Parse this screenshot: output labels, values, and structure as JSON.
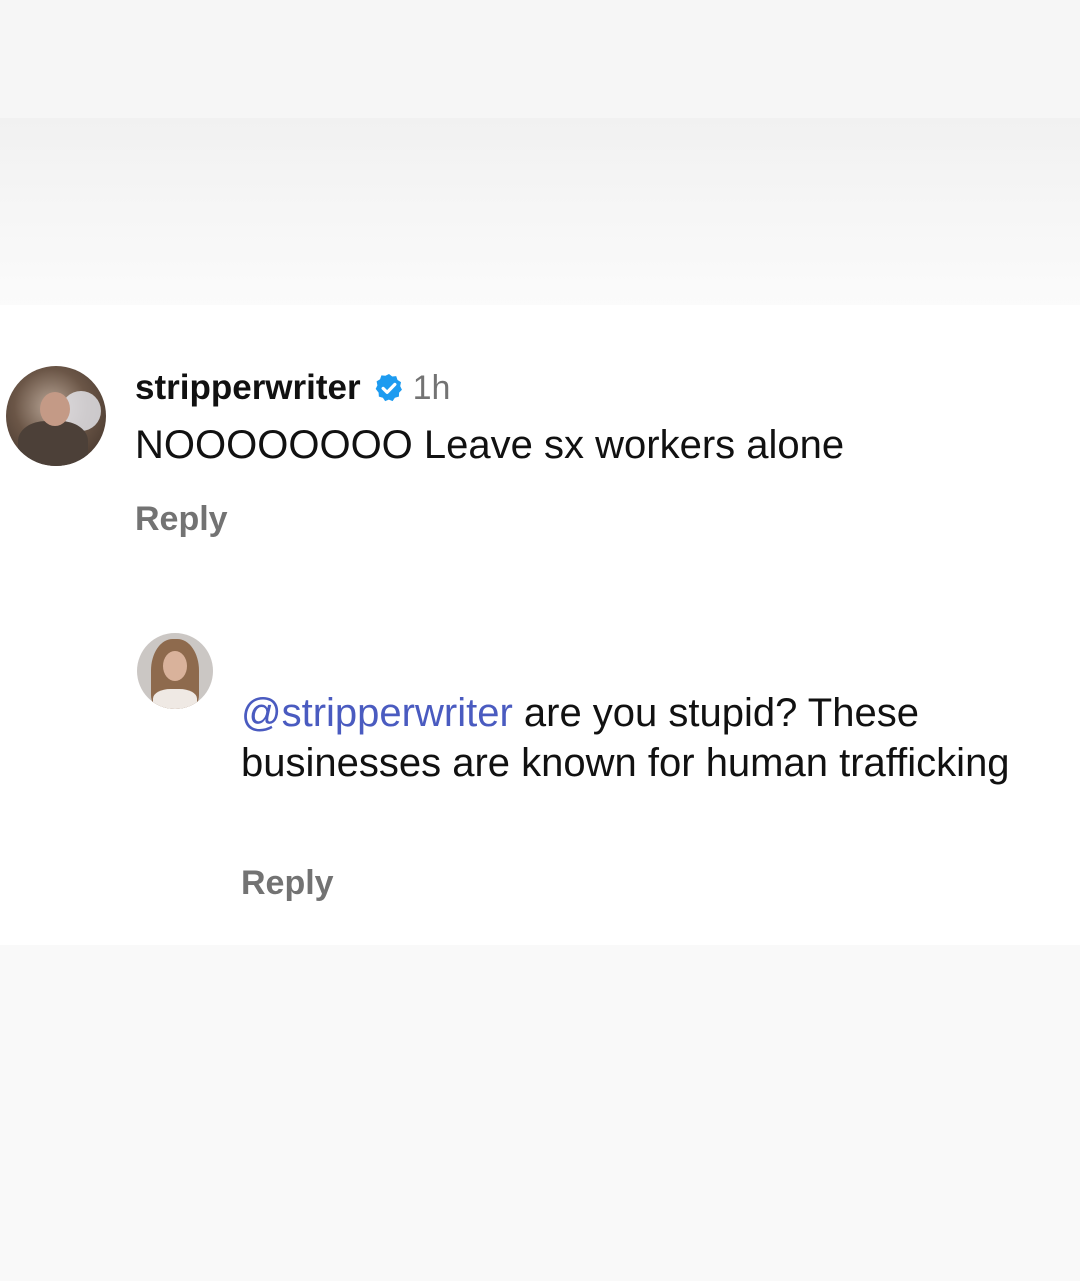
{
  "comments": [
    {
      "username": "stripperwriter",
      "verified": true,
      "time": "1h",
      "text": "NOOOOOOOO Leave sx workers alone",
      "reply_label": "Reply",
      "avatar_icon": "user-avatar-photo"
    },
    {
      "mention": "@stripperwriter",
      "text": " are you stupid? These businesses are known for human trafficking",
      "reply_label": "Reply",
      "avatar_icon": "user-avatar-photo"
    }
  ],
  "colors": {
    "verified_badge": "#1d9bf0",
    "mention": "#4a5bc0",
    "secondary_text": "#737373",
    "primary_text": "#111111"
  }
}
